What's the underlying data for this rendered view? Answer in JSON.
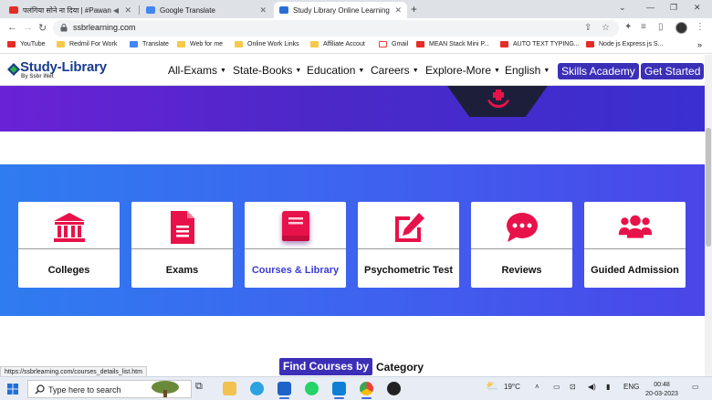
{
  "browser": {
    "tabs": [
      {
        "title": "पलंगिया सोने ना दिया | #Pawan"
      },
      {
        "title": "Google Translate"
      },
      {
        "title": "Study Library Online Learning"
      }
    ],
    "url": "ssbrlearning.com",
    "bookmarks": [
      {
        "label": "YouTube",
        "icon": "youtube-icon"
      },
      {
        "label": "Redmil For Work",
        "icon": "folder-icon"
      },
      {
        "label": "Translate",
        "icon": "translate-icon"
      },
      {
        "label": "Web for me",
        "icon": "folder-icon"
      },
      {
        "label": "Online Work Links",
        "icon": "folder-icon"
      },
      {
        "label": "Affiliate Accout",
        "icon": "folder-icon"
      },
      {
        "label": "Gmail",
        "icon": "gmail-icon"
      },
      {
        "label": "MEAN Stack Mini P...",
        "icon": "youtube-icon"
      },
      {
        "label": "AUTO TEXT TYPING...",
        "icon": "youtube-icon"
      },
      {
        "label": "Node js Express js S...",
        "icon": "youtube-icon"
      }
    ],
    "more_bookmarks": "»",
    "status_url": "https://ssbrlearning.com/courses_details_list.htm"
  },
  "site": {
    "logo": {
      "title": "Study-Library",
      "subtitle": "By Ssbr iNet"
    },
    "nav": [
      {
        "label": "All-Exams"
      },
      {
        "label": "State-Books"
      },
      {
        "label": "Education"
      },
      {
        "label": "Careers"
      },
      {
        "label": "Explore-More"
      },
      {
        "label": "English"
      }
    ],
    "buttons": {
      "skills": "Skills Academy",
      "started": "Get Started"
    }
  },
  "categories": [
    {
      "label": "Colleges",
      "icon": "university-icon"
    },
    {
      "label": "Exams",
      "icon": "document-icon"
    },
    {
      "label": "Courses & Library",
      "icon": "book-icon",
      "highlighted": true
    },
    {
      "label": "Psychometric Test",
      "icon": "edit-icon"
    },
    {
      "label": "Reviews",
      "icon": "comment-icon"
    },
    {
      "label": "Guided Admission",
      "icon": "users-icon"
    }
  ],
  "find": {
    "highlight": "Find Courses by",
    "rest": "Category"
  },
  "taskbar": {
    "search_placeholder": "Type here to search",
    "weather": "19°C",
    "language": "ENG",
    "time": "00:48",
    "date": "20-03-2023"
  },
  "colors": {
    "accent": "#e8124a",
    "brand": "#3b2fb8",
    "band_start": "#2f7cf0",
    "band_end": "#4a45e8"
  }
}
